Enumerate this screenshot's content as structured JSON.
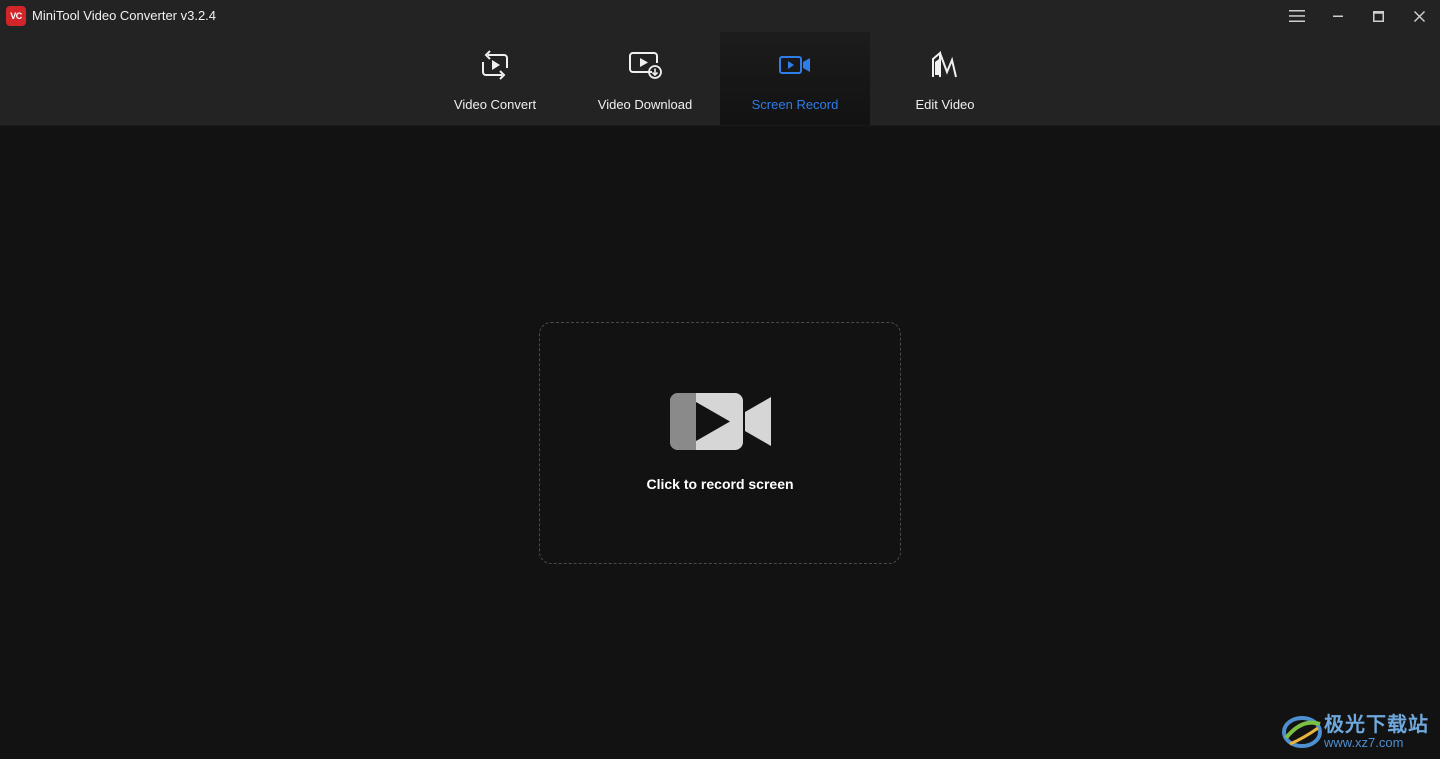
{
  "app": {
    "title": "MiniTool Video Converter v3.2.4",
    "logo_text": "VC",
    "accent_color": "#2f7de8",
    "logo_color": "#d0262a"
  },
  "window_controls": {
    "menu": "hamburger-icon",
    "minimize": "minimize-icon",
    "maximize": "maximize-icon",
    "close": "close-icon"
  },
  "tabs": [
    {
      "label": "Video Convert",
      "icon": "video-convert-icon",
      "active": false
    },
    {
      "label": "Video Download",
      "icon": "video-download-icon",
      "active": false
    },
    {
      "label": "Screen Record",
      "icon": "screen-record-icon",
      "active": true
    },
    {
      "label": "Edit Video",
      "icon": "edit-video-icon",
      "active": false
    }
  ],
  "record": {
    "label": "Click to record screen",
    "icon": "video-camera-icon"
  },
  "watermark": {
    "title": "极光下载站",
    "url": "www.xz7.com"
  }
}
